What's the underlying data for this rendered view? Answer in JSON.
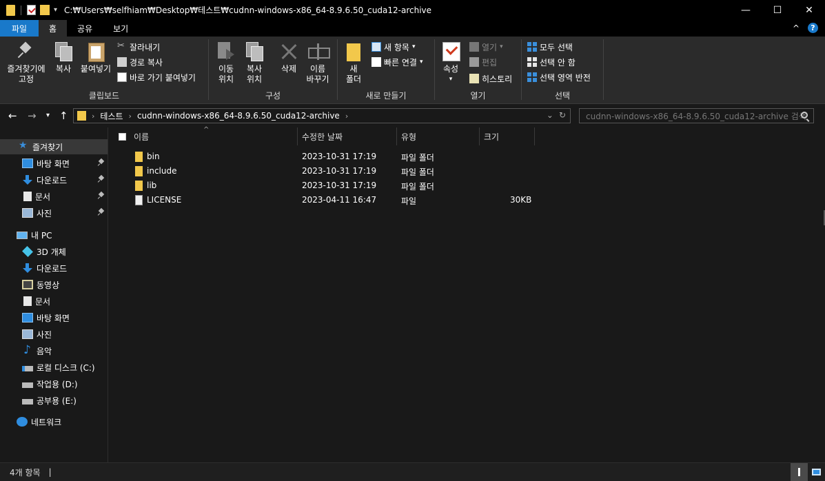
{
  "window": {
    "title_path": "C:₩Users₩selfhiam₩Desktop₩테스트₩cudnn-windows-x86_64-8.9.6.50_cuda12-archive",
    "minimize": "—",
    "maximize": "☐",
    "close": "✕"
  },
  "tabs": [
    {
      "label": "파일"
    },
    {
      "label": "홈"
    },
    {
      "label": "공유"
    },
    {
      "label": "보기"
    }
  ],
  "help_label": "?",
  "collapse_label": "^",
  "ribbon": {
    "clipboard": {
      "pin_line1": "즐겨찾기에",
      "pin_line2": "고정",
      "copy": "복사",
      "paste": "붙여넣기",
      "cut": "잘라내기",
      "copy_path": "경로 복사",
      "paste_shortcut": "바로 가기 붙여넣기",
      "label": "클립보드"
    },
    "organize": {
      "move_line1": "이동",
      "move_line2": "위치",
      "copyto_line1": "복사",
      "copyto_line2": "위치",
      "delete": "삭제",
      "rename_line1": "이름",
      "rename_line2": "바꾸기",
      "label": "구성"
    },
    "new": {
      "newfolder_line1": "새",
      "newfolder_line2": "폴더",
      "new_item": "새 항목",
      "easy_access": "빠른 연결",
      "label": "새로 만들기"
    },
    "open": {
      "properties": "속성",
      "open": "열기",
      "edit": "편집",
      "history": "히스토리",
      "label": "열기"
    },
    "select": {
      "select_all": "모두 선택",
      "select_none": "선택 안 함",
      "invert": "선택 영역 반전",
      "label": "선택"
    }
  },
  "address": {
    "crumbs": [
      "테스트",
      "cudnn-windows-x86_64-8.9.6.50_cuda12-archive"
    ],
    "search_placeholder": "cudnn-windows-x86_64-8.9.6.50_cuda12-archive 검색"
  },
  "nav": {
    "quick_access": "즐겨찾기",
    "quick_items": [
      "바탕 화면",
      "다운로드",
      "문서",
      "사진"
    ],
    "this_pc": "내 PC",
    "pc_items": [
      "3D 개체",
      "다운로드",
      "동영상",
      "문서",
      "바탕 화면",
      "사진",
      "음악",
      "로컬 디스크 (C:)",
      "작업용 (D:)",
      "공부용 (E:)"
    ],
    "network": "네트워크"
  },
  "columns": {
    "name": "이름",
    "modified": "수정한 날짜",
    "type": "유형",
    "size": "크기"
  },
  "files": [
    {
      "name": "bin",
      "modified": "2023-10-31 17:19",
      "type": "파일 폴더",
      "size": ""
    },
    {
      "name": "include",
      "modified": "2023-10-31 17:19",
      "type": "파일 폴더",
      "size": ""
    },
    {
      "name": "lib",
      "modified": "2023-10-31 17:19",
      "type": "파일 폴더",
      "size": ""
    },
    {
      "name": "LICENSE",
      "modified": "2023-04-11 16:47",
      "type": "파일",
      "size": "30KB"
    }
  ],
  "status": {
    "count": "4개 항목",
    "divider": "|"
  },
  "colors": {
    "accent": "#1979ca",
    "folder": "#f2c84b",
    "background": "#191919"
  }
}
